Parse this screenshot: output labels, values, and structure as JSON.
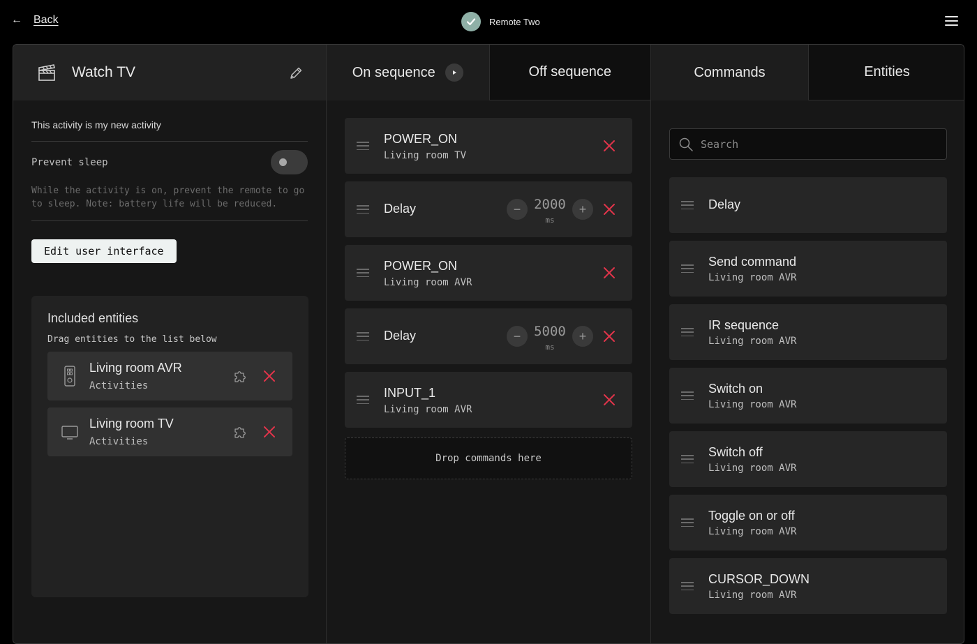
{
  "topbar": {
    "back_label": "Back",
    "device_name": "Remote Two"
  },
  "activity": {
    "title": "Watch TV",
    "description": "This activity is my new activity",
    "prevent_sleep_label": "Prevent sleep",
    "prevent_sleep_enabled": false,
    "prevent_sleep_note": "While the activity is on, prevent the remote to go to sleep. Note: battery life will be reduced.",
    "edit_ui_label": "Edit user interface"
  },
  "entities": {
    "heading": "Included entities",
    "hint": "Drag entities to the list below",
    "items": [
      {
        "name": "Living room AVR",
        "kind": "Activities",
        "icon": "remote-icon"
      },
      {
        "name": "Living room TV",
        "kind": "Activities",
        "icon": "tv-icon"
      }
    ]
  },
  "tabs": {
    "on_sequence": "On sequence",
    "off_sequence": "Off sequence",
    "commands": "Commands",
    "entities": "Entities"
  },
  "sequence": {
    "items": [
      {
        "type": "command",
        "name": "POWER_ON",
        "entity": "Living room TV"
      },
      {
        "type": "delay",
        "name": "Delay",
        "value": "2000",
        "unit": "ms"
      },
      {
        "type": "command",
        "name": "POWER_ON",
        "entity": "Living room AVR"
      },
      {
        "type": "delay",
        "name": "Delay",
        "value": "5000",
        "unit": "ms"
      },
      {
        "type": "command",
        "name": "INPUT_1",
        "entity": "Living room AVR"
      }
    ],
    "drop_hint": "Drop commands here"
  },
  "commands": {
    "search_placeholder": "Search",
    "items": [
      {
        "name": "Delay",
        "entity": ""
      },
      {
        "name": "Send command",
        "entity": "Living room AVR"
      },
      {
        "name": "IR sequence",
        "entity": "Living room AVR"
      },
      {
        "name": "Switch on",
        "entity": "Living room AVR"
      },
      {
        "name": "Switch off",
        "entity": "Living room AVR"
      },
      {
        "name": "Toggle on or off",
        "entity": "Living room AVR"
      },
      {
        "name": "CURSOR_DOWN",
        "entity": "Living room AVR"
      }
    ]
  },
  "colors": {
    "accent_check": "#8fb0a7",
    "remove_red": "#e0344a",
    "panel_bg": "#171717",
    "card_bg": "#262626"
  }
}
